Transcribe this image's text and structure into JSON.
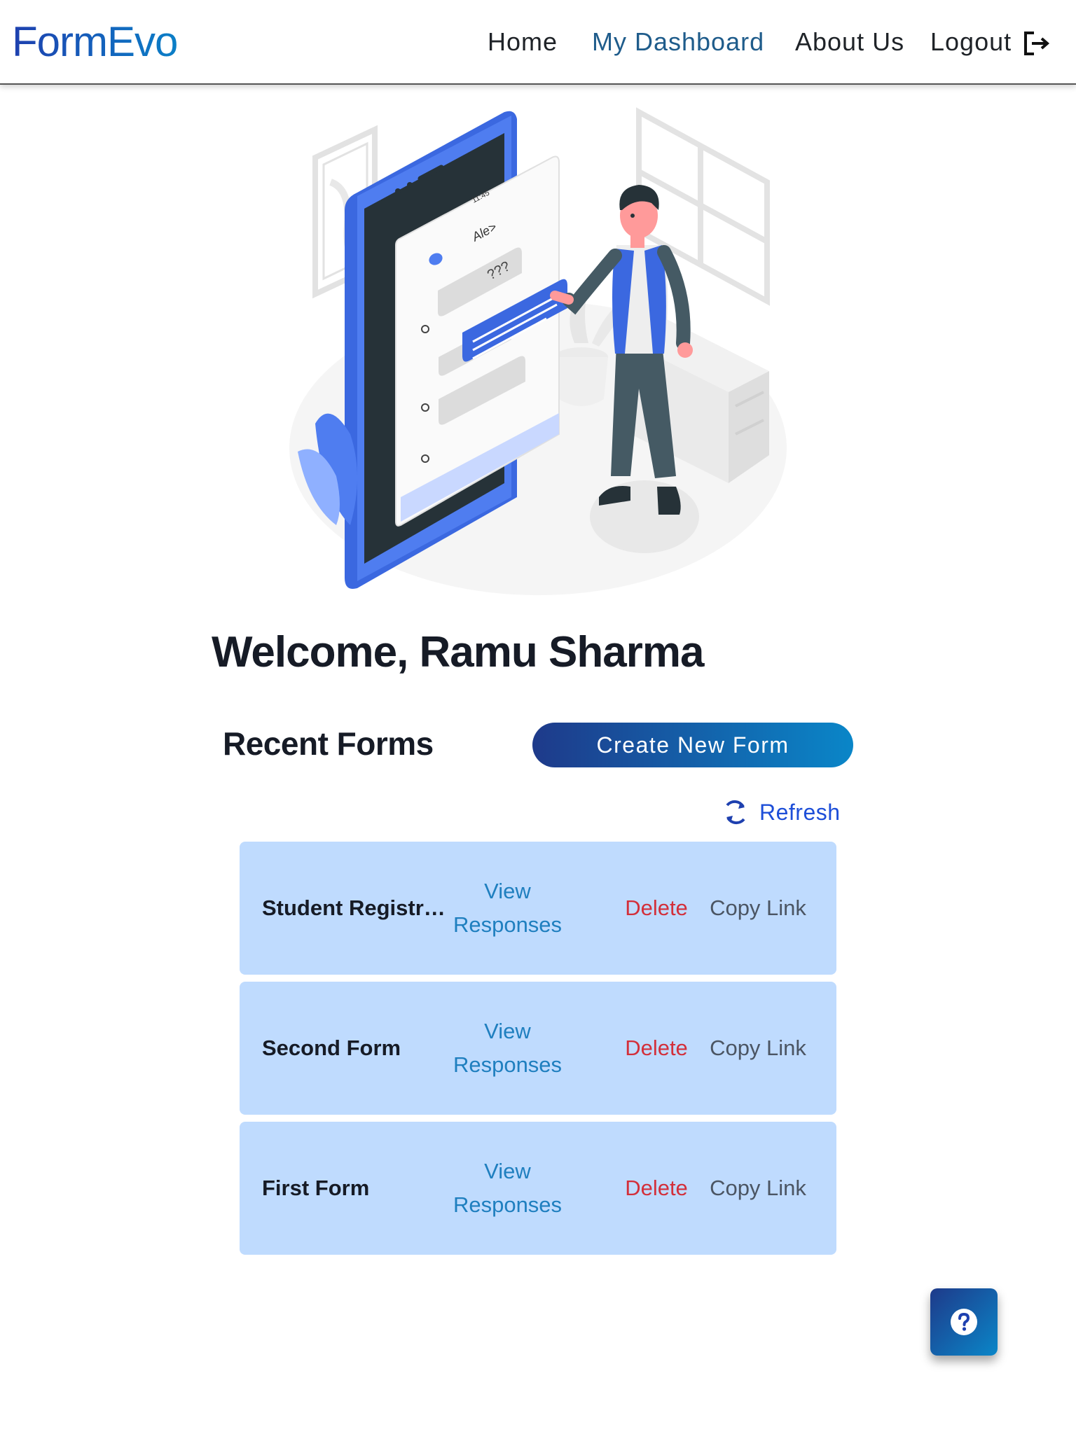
{
  "app": {
    "brand": "FormEvo"
  },
  "nav": {
    "items": [
      {
        "label": "Home",
        "active": false
      },
      {
        "label": "My Dashboard",
        "active": true
      },
      {
        "label": "About Us",
        "active": false
      },
      {
        "label": "Logout",
        "active": false
      }
    ],
    "logout_icon": "logout-arrow-icon"
  },
  "hero": {
    "phone_time": "11:45",
    "chat_name": "Ale>",
    "bubble_text": "???"
  },
  "welcome": {
    "text": "Welcome, Ramu Sharma"
  },
  "recent": {
    "title": "Recent Forms",
    "create_label": "Create New Form",
    "refresh_label": "Refresh",
    "refresh_icon": "refresh-icon"
  },
  "forms": [
    {
      "name": "Student Registra...",
      "view_label": "View Responses",
      "delete_label": "Delete",
      "copy_label": "Copy Link"
    },
    {
      "name": "Second Form",
      "view_label": "View Responses",
      "delete_label": "Delete",
      "copy_label": "Copy Link"
    },
    {
      "name": "First Form",
      "view_label": "View Responses",
      "delete_label": "Delete",
      "copy_label": "Copy Link"
    }
  ],
  "help": {
    "icon": "help-question-icon"
  },
  "colors": {
    "brand_gradient_start": "#1e40af",
    "brand_gradient_end": "#0b7fc7",
    "card_bg": "#bfdbfe",
    "view_link": "#1f7fbf",
    "delete_link": "#d32f3a",
    "copy_link": "#4b5563",
    "active_nav": "#1f5c8b"
  }
}
